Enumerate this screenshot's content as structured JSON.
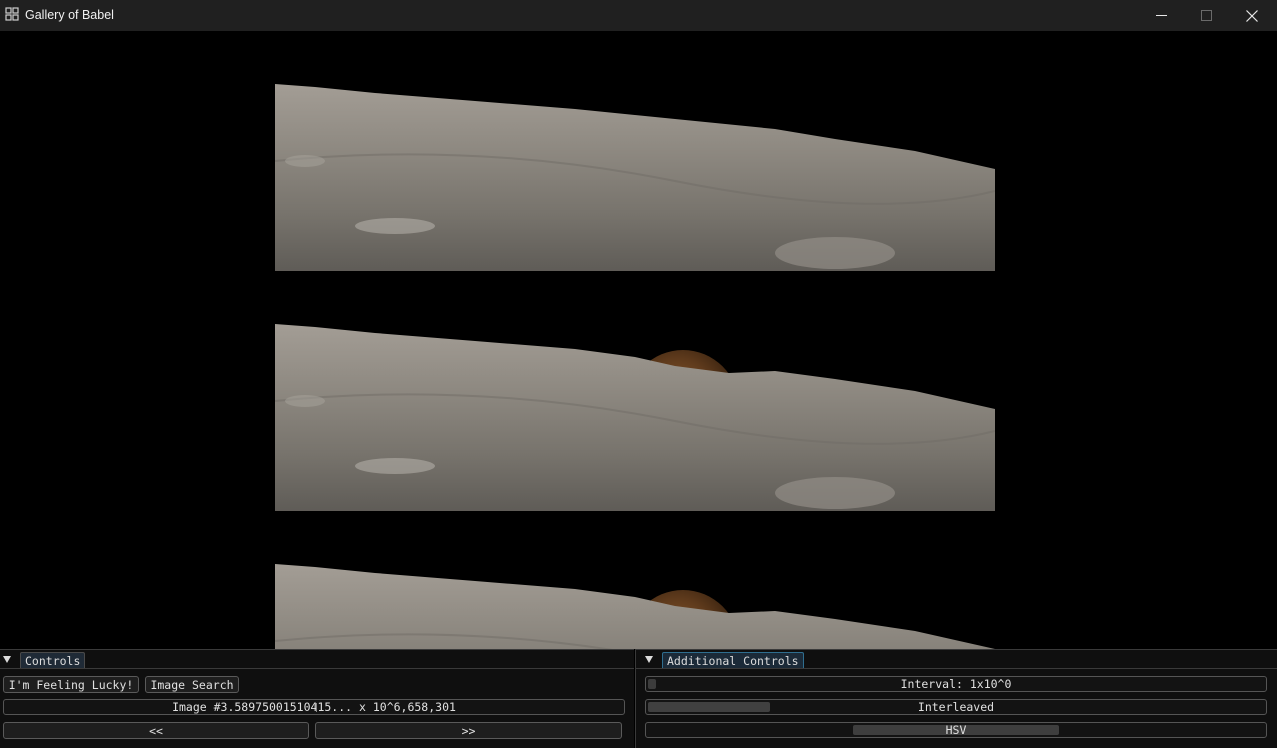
{
  "window": {
    "title": "Gallery of Babel",
    "icons": [
      "app-icon",
      "minimize-icon",
      "maximize-icon",
      "close-icon"
    ]
  },
  "viewport": {
    "frames": [
      {
        "name": "lunar-horizon-frame-1",
        "earth_visible": false
      },
      {
        "name": "lunar-horizon-frame-2",
        "earth_visible": true
      },
      {
        "name": "lunar-horizon-frame-3",
        "earth_visible": true
      }
    ]
  },
  "controls": {
    "tab_label": "Controls",
    "lucky_button": "I'm Feeling Lucky!",
    "search_button": "Image Search",
    "image_index": "Image #3.58975001510415... x 10^6,658,301",
    "prev_button": "<<",
    "next_button": ">>"
  },
  "additional_controls": {
    "tab_label": "Additional Controls",
    "interval_text": "Interval: 1x10^0",
    "interval_level": 0.01,
    "mode_text": "Interleaved",
    "mode_fill": 0.2,
    "color_space": "HSV"
  },
  "colors": {
    "accent_tab_border": "#2f6e8f",
    "panel_bg": "#0f0f0f",
    "titlebar_bg": "#202020"
  }
}
